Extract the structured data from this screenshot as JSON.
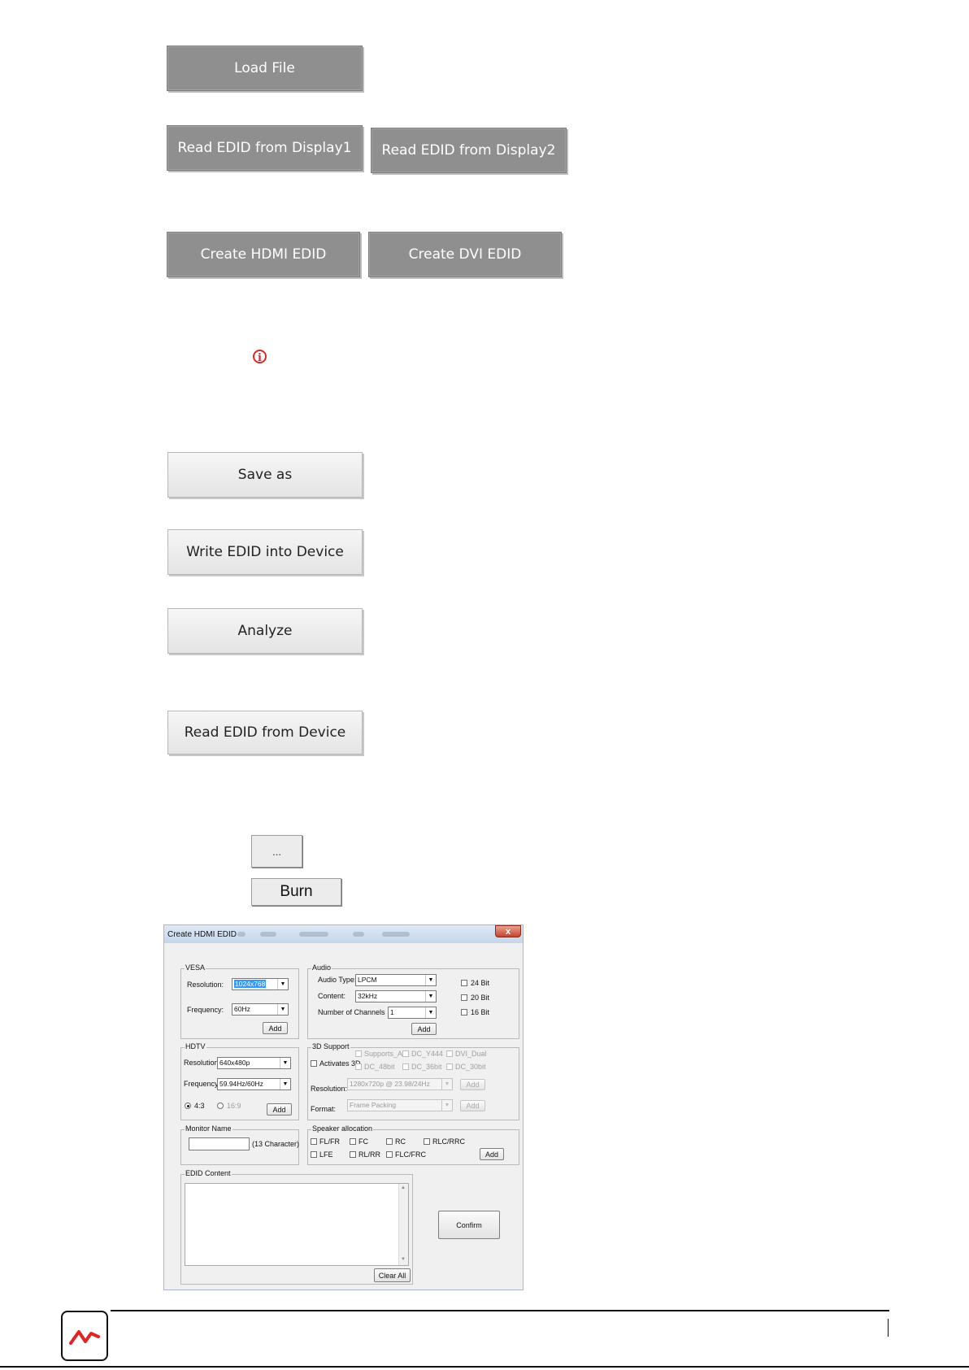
{
  "buttons": {
    "load_file": "Load File",
    "read_display1": "Read EDID from Display1",
    "read_display2": "Read EDID from Display2",
    "create_hdmi": "Create HDMI EDID",
    "create_dvi": "Create DVI EDID",
    "save_as": "Save as",
    "write_device": "Write EDID into Device",
    "analyze": "Analyze",
    "read_device": "Read EDID from Device",
    "browse": "...",
    "burn": "Burn"
  },
  "dialog": {
    "title": "Create HDMI EDID",
    "close": "x",
    "vesa": {
      "legend": "VESA",
      "resolution_label": "Resolution:",
      "resolution_value": "1024x768",
      "frequency_label": "Frequency:",
      "frequency_value": "60Hz",
      "add": "Add"
    },
    "audio": {
      "legend": "Audio",
      "type_label": "Audio Type:",
      "type_value": "LPCM",
      "content_label": "Content:",
      "content_value": "32kHz",
      "channels_label": "Number of Channels",
      "channels_value": "1",
      "bit24": "24 Bit",
      "bit20": "20 Bit",
      "bit16": "16 Bit",
      "add": "Add"
    },
    "hdtv": {
      "legend": "HDTV",
      "resolution_label": "Resolution:",
      "resolution_value": "640x480p",
      "frequency_label": "Frequency:",
      "frequency_value": "59.94Hz/60Hz",
      "ratio_43": "4:3",
      "ratio_169": "16:9",
      "add": "Add"
    },
    "support3d": {
      "legend": "3D Support",
      "activates": "Activates 3D",
      "supports_ai": "Supports_AI",
      "dc_y444": "DC_Y444",
      "dvi_dual": "DVI_Dual",
      "dc_48bit": "DC_48bit",
      "dc_36bit": "DC_36bit",
      "dc_30bit": "DC_30bit",
      "resolution_label": "Resolution:",
      "resolution_value": "1280x720p @ 23.98/24Hz",
      "format_label": "Format:",
      "format_value": "Frame Packing",
      "add": "Add"
    },
    "monitor": {
      "legend": "Monitor Name",
      "hint": "(13 Character)"
    },
    "speaker": {
      "legend": "Speaker allocation",
      "fl_fr": "FL/FR",
      "fc": "FC",
      "rc": "RC",
      "rlc_rrc": "RLC/RRC",
      "lfe": "LFE",
      "rl_rr": "RL/RR",
      "flc_frc": "FLC/FRC",
      "add": "Add"
    },
    "edid": {
      "legend": "EDID Content",
      "clear": "Clear All"
    },
    "confirm": "Confirm"
  },
  "icons": {
    "info": "i",
    "scroll_up": "▲",
    "scroll_down": "▼",
    "dropdown": "▼"
  },
  "colors": {
    "gray_button": "#8f8f8f",
    "info_red": "#d62b2b"
  }
}
